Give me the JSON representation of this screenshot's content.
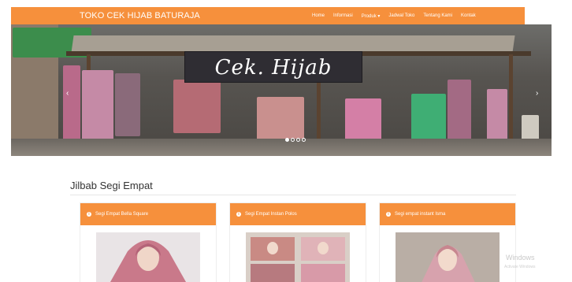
{
  "navbar": {
    "brand": "TOKO CEK HIJAB BATURAJA",
    "links": [
      "Home",
      "Informasi",
      "Produk ▾",
      "Jadwal Toko",
      "Tentang Kami",
      "Kontak"
    ]
  },
  "hero": {
    "sign_text": "Cek. Hijab",
    "slide_dots": 4,
    "active_slide": 1
  },
  "section": {
    "title": "Jilbab Segi Empat"
  },
  "cards": [
    {
      "title": "Segi Empat Bella Square"
    },
    {
      "title": "Segi Empat Instan Polos"
    },
    {
      "title": "Segi empat instant Isma"
    }
  ],
  "watermark": {
    "title": "Windows",
    "subtitle": "Activate Windows"
  },
  "colors": {
    "accent": "#f6903c",
    "text": "#333333"
  }
}
